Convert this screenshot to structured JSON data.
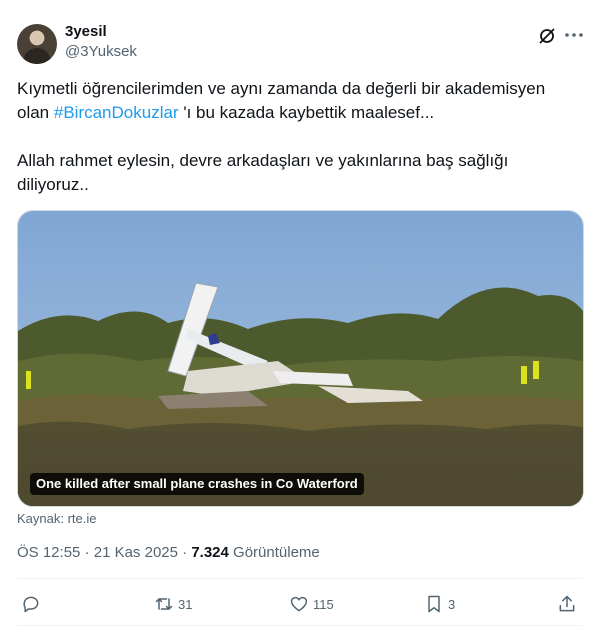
{
  "author": {
    "display_name": "3yesil",
    "handle": "@3Yuksek",
    "avatar_icon": "user-avatar"
  },
  "tweet": {
    "line1_pre": "Kıymetli öğrencilerimden ve aynı zamanda da değerli bir akademisyen olan ",
    "hashtag": "#BircanDokuzlar",
    "line1_post": " 'ı bu kazada kaybettik maalesef...",
    "paragraph2": "Allah rahmet eylesin, devre arkadaşları ve yakınlarına baş sağlığı diliyoruz.."
  },
  "media": {
    "caption": "One killed after small plane crashes in Co Waterford",
    "source_label": "Kaynak: rte.ie"
  },
  "meta": {
    "time": "ÖS 12:55",
    "separator": "·",
    "date": "21 Kas 2025",
    "views_count": "7.324",
    "views_label": "Görüntüleme"
  },
  "actions": {
    "reply_count": "",
    "retweet_count": "31",
    "like_count": "115",
    "bookmark_count": "3"
  },
  "icons": [
    "grok-icon",
    "more-icon",
    "reply-icon",
    "retweet-icon",
    "like-icon",
    "bookmark-icon",
    "share-icon"
  ],
  "colors": {
    "accent": "#1d9bf0",
    "text": "#0f1419",
    "secondary": "#536471",
    "divider": "#eff3f4"
  }
}
